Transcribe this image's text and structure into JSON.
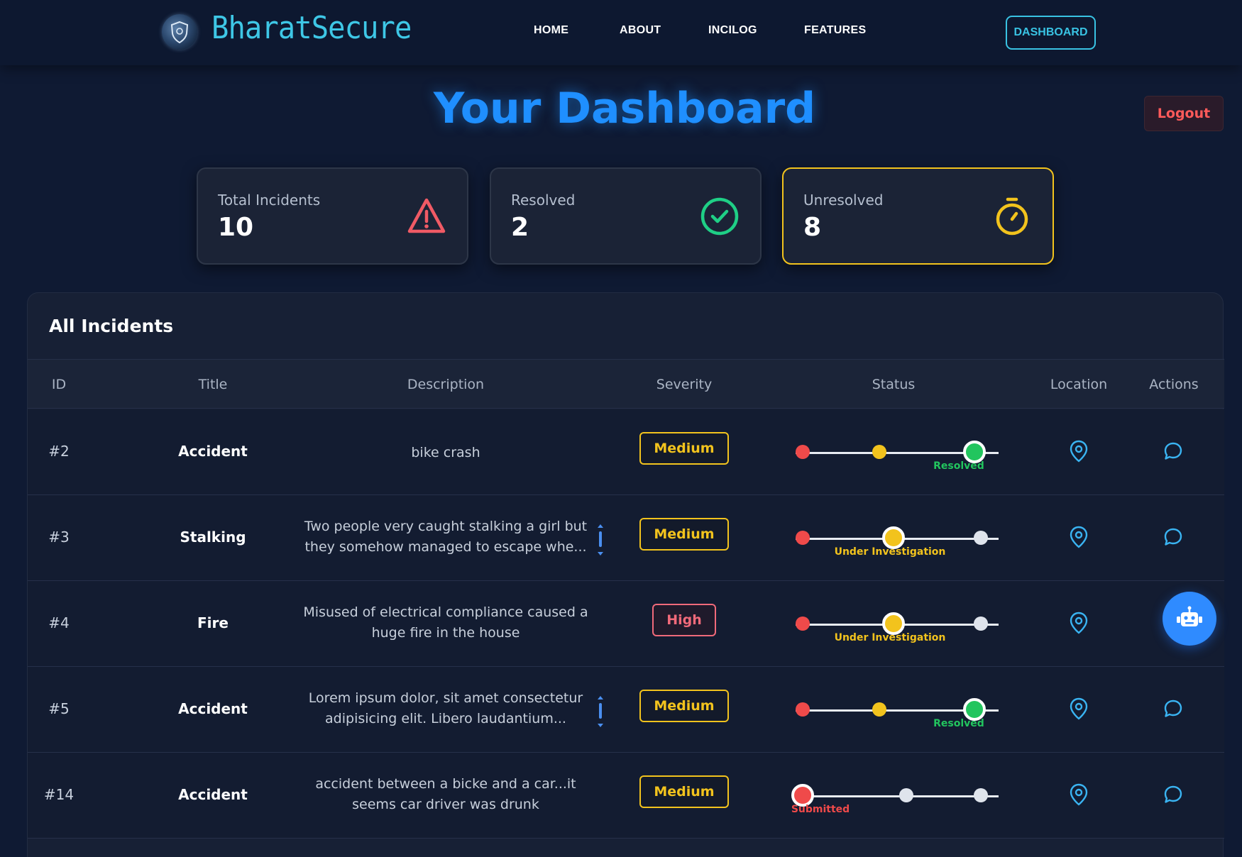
{
  "nav": {
    "brand": "BharatSecure",
    "links": [
      "HOME",
      "ABOUT",
      "INCILOG",
      "FEATURES"
    ],
    "dashboard_button": "DASHBOARD"
  },
  "header": {
    "title": "Your Dashboard",
    "logout_label": "Logout"
  },
  "stats": [
    {
      "label": "Total Incidents",
      "value": "10",
      "icon": "warning-triangle-icon",
      "color": "#f05a65"
    },
    {
      "label": "Resolved",
      "value": "2",
      "icon": "check-circle-icon",
      "color": "#1fcf86"
    },
    {
      "label": "Unresolved",
      "value": "8",
      "icon": "stopwatch-icon",
      "color": "#f2c31d"
    }
  ],
  "table": {
    "title": "All Incidents",
    "columns": [
      "ID",
      "Title",
      "Description",
      "Severity",
      "Status",
      "Location",
      "Actions"
    ],
    "rows": [
      {
        "id": "#2",
        "title": "Accident",
        "description": "bike crash",
        "severity": "Medium",
        "status": "Resolved",
        "stage": 2
      },
      {
        "id": "#3",
        "title": "Stalking",
        "description": "Two people very caught stalking a girl but they somehow managed to escape whe...",
        "severity": "Medium",
        "status": "Under Investigation",
        "stage": 1
      },
      {
        "id": "#4",
        "title": "Fire",
        "description": "Misused of electrical compliance caused a huge fire in the house",
        "severity": "High",
        "status": "Under Investigation",
        "stage": 1
      },
      {
        "id": "#5",
        "title": "Accident",
        "description": "Lorem ipsum dolor, sit amet consectetur adipisicing elit. Libero laudantium...",
        "severity": "Medium",
        "status": "Resolved",
        "stage": 2
      },
      {
        "id": "#14",
        "title": "Accident",
        "description": "accident between a bicke and a car...it seems car driver was drunk",
        "severity": "Medium",
        "status": "Submitted",
        "stage": 0
      }
    ]
  },
  "colors": {
    "submitted": "#ef4a4a",
    "investigation": "#f2c31d",
    "resolved": "#22c55e",
    "pending": "#dfe4ec",
    "accent": "#1f8fff"
  }
}
